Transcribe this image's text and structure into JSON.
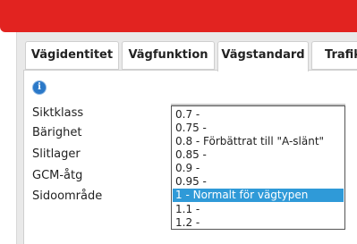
{
  "tabs": [
    {
      "label": "Vägidentitet"
    },
    {
      "label": "Vägfunktion"
    },
    {
      "label": "Vägstandard"
    },
    {
      "label": "Trafik"
    }
  ],
  "active_tab": "Vägstandard",
  "fields": {
    "siktklass": "Siktklass",
    "barighet": "Bärighet",
    "slitlager": "Slitlager",
    "gcm": "GCM-åtg",
    "sidoomrade": "Sidoområde"
  },
  "dropdown": {
    "options": [
      "0.7 -",
      "0.75 -",
      "0.8 - Förbättrat till \"A-slänt\"",
      "0.85 -",
      "0.9 -",
      "0.95 -",
      "1 - Normalt för vägtypen",
      "1.1 -",
      "1.2 -"
    ],
    "selected_index": 6
  },
  "colors": {
    "header_red": "#e22320",
    "selection_blue": "#2f9ad8",
    "info_icon_blue": "#2a78c8"
  },
  "icons": {
    "info": "info-icon"
  },
  "info_glyph": "i"
}
